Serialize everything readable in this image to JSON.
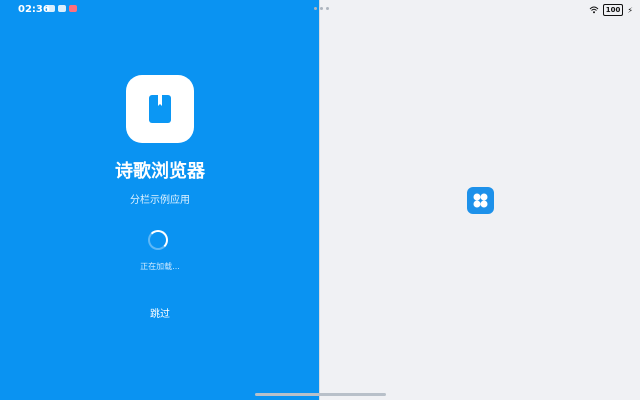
{
  "status": {
    "time": "02:36",
    "battery": "100"
  },
  "splash": {
    "app_name": "诗歌浏览器",
    "subtitle": "分栏示例应用",
    "loading": "正在加载...",
    "skip": "跳过"
  },
  "icons": {
    "app": "book-icon",
    "placeholder": "four-petal-icon",
    "wifi": "wifi-icon",
    "charging": "bolt-icon"
  },
  "colors": {
    "left_bg": "#0a93f2",
    "right_bg": "#f0f1f4",
    "accent": "#1d91ea"
  }
}
